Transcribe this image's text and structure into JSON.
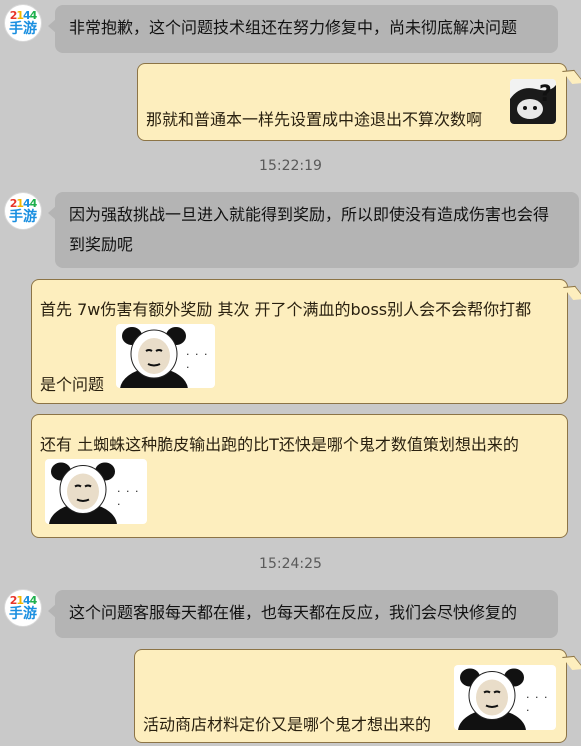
{
  "avatar": {
    "logo_digits": [
      "2",
      "1",
      "4",
      "4"
    ],
    "logo_text": "手游"
  },
  "messages": {
    "m1": "非常抱歉，这个问题技术组还在努力修复中，尚未彻底解决问题",
    "m2": "那就和普通本一样先设置成中途退出不算次数啊",
    "t1": "15:22:19",
    "m3_line1": "因为强敌挑战一旦进入就能得到奖励，所以即使没有造成伤害也会得",
    "m3_line2": "到奖励呢",
    "m4_line1": "首先 7w伤害有额外奖励 其次 开了个满血的boss别人会不会帮你打都",
    "m4_line2": "是个问题",
    "m5": "还有 土蜘蛛这种脆皮输出跑的比T还快是哪个鬼才数值策划想出来的",
    "t2": "15:24:25",
    "m6": "这个问题客服每天都在催，也每天都在反应，我们会尽快修复的",
    "m7": "活动商店材料定价又是哪个鬼才想出来的"
  },
  "stickers": {
    "dots": "· · · ·"
  },
  "icons": [
    "question-sticker-icon",
    "panda-meme-icon"
  ]
}
